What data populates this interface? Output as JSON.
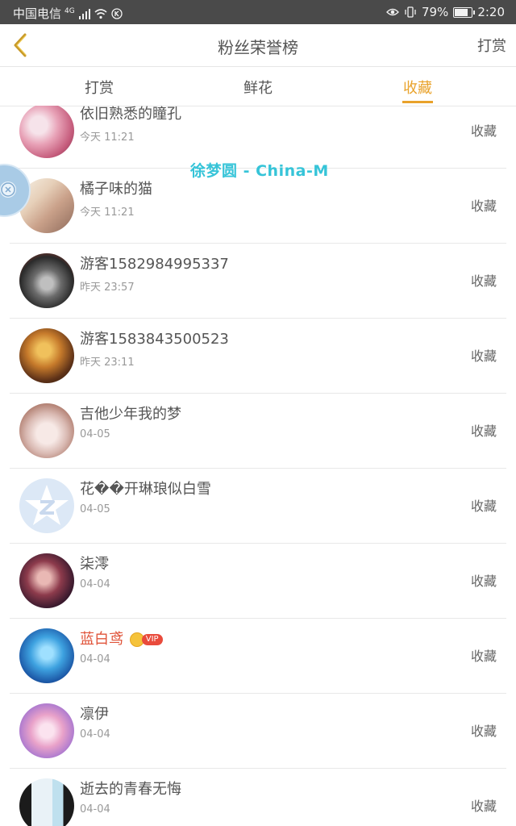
{
  "status_bar": {
    "carrier": "中国电信",
    "network": "4G",
    "battery": "79%",
    "battery_level": 0.79,
    "time": "2:20"
  },
  "header": {
    "title": "粉丝荣誉榜",
    "right_action": "打赏"
  },
  "tabs": [
    {
      "label": "打赏",
      "active": false
    },
    {
      "label": "鲜花",
      "active": false
    },
    {
      "label": "收藏",
      "active": true
    }
  ],
  "watermark": "徐梦圆 - China-M",
  "list": [
    {
      "name": "依旧熟悉的瞳孔",
      "time": "今天 11:21",
      "action": "收藏"
    },
    {
      "name": "橘子味的猫",
      "time": "今天 11:21",
      "action": "收藏"
    },
    {
      "name": "游客1582984995337",
      "time": "昨天 23:57",
      "action": "收藏"
    },
    {
      "name": "游客1583843500523",
      "time": "昨天 23:11",
      "action": "收藏"
    },
    {
      "name": "吉他少年我的梦",
      "time": "04-05",
      "action": "收藏"
    },
    {
      "name": "花��开琳琅似白雪",
      "time": "04-05",
      "action": "收藏"
    },
    {
      "name": "柒澪",
      "time": "04-04",
      "action": "收藏"
    },
    {
      "name": "蓝白鸢",
      "time": "04-04",
      "action": "收藏",
      "vip": true,
      "vip_label": "VIP"
    },
    {
      "name": "凛伊",
      "time": "04-04",
      "action": "收藏"
    },
    {
      "name": "逝去的青春无悔",
      "time": "04-04",
      "action": "收藏"
    }
  ],
  "colors": {
    "accent": "#e9a22a",
    "vip_name": "#e0543a",
    "watermark": "#36c4d8"
  }
}
